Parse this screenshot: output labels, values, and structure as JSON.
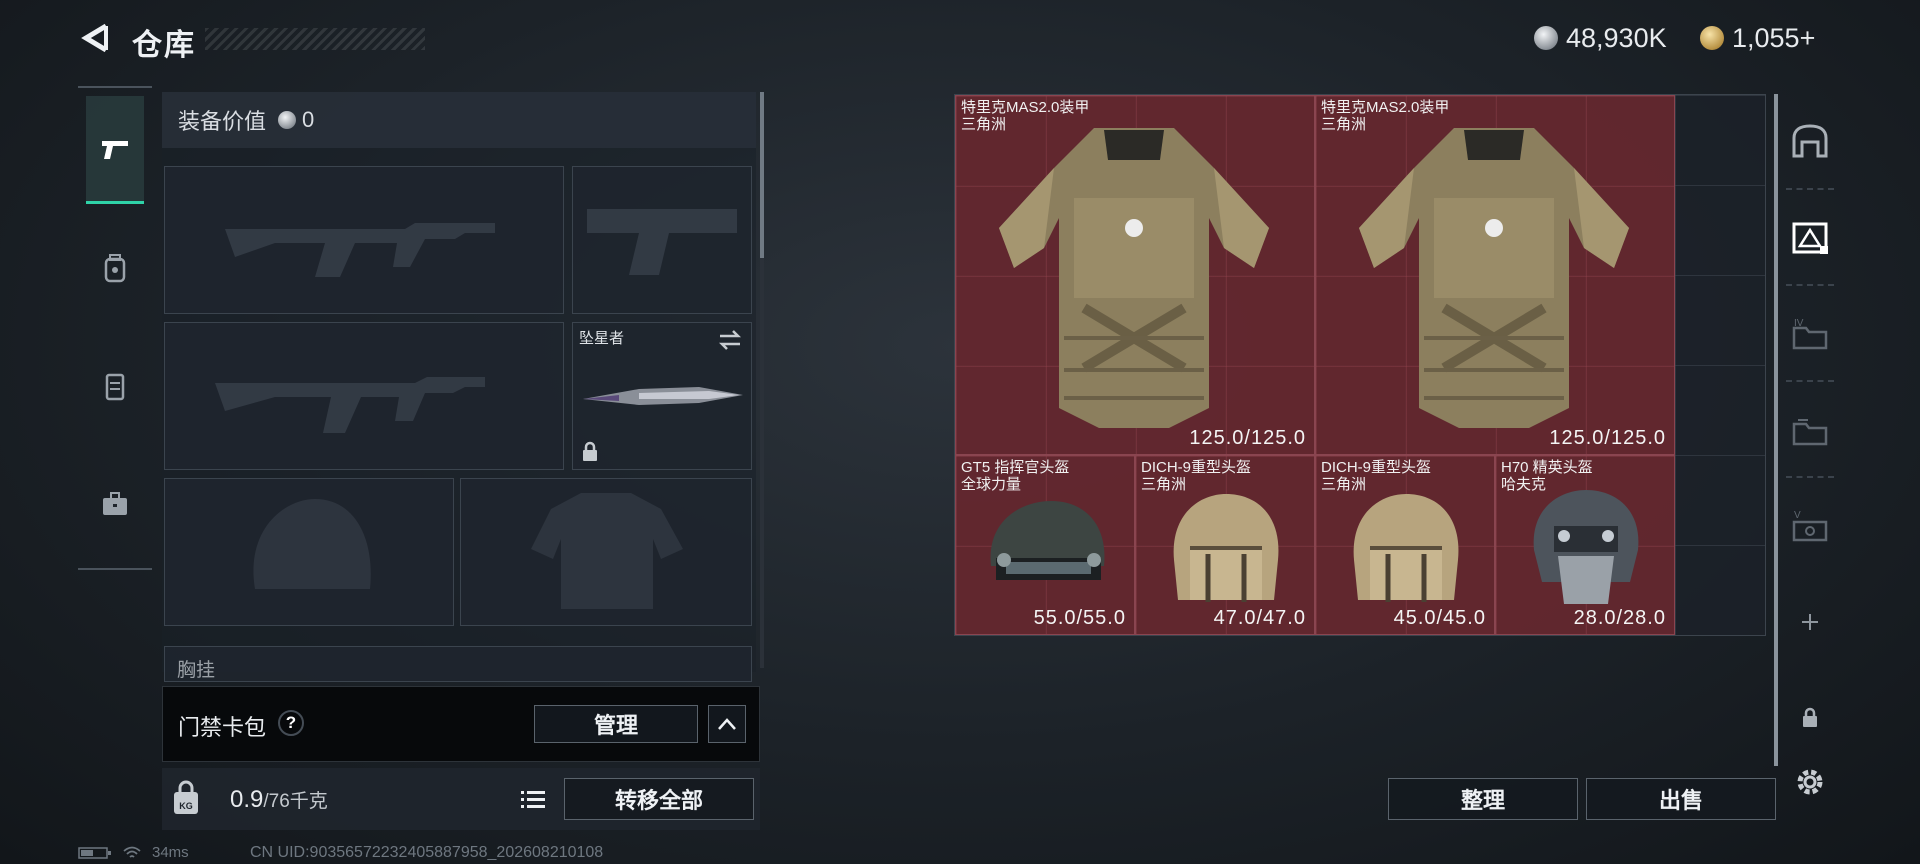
{
  "header": {
    "title": "仓库",
    "currency_silver": "48,930K",
    "currency_gold": "1,055+"
  },
  "equipment": {
    "value_label": "装备价值",
    "value": "0",
    "melee_name": "坠星者",
    "chest_rig_label": "胸挂"
  },
  "keycard": {
    "label": "门禁卡包",
    "help": "?",
    "manage_label": "管理"
  },
  "weight": {
    "current": "0.9",
    "capacity": "/76千克",
    "transfer_all_label": "转移全部"
  },
  "status": {
    "ping": "34ms",
    "uid": "CN UID:9035657223240588​7958_202608210108"
  },
  "storage": {
    "items": [
      {
        "name": "特里克MAS2.0装甲",
        "sub": "三角洲",
        "durability": "125.0/125.0",
        "type": "armor"
      },
      {
        "name": "特里克MAS2.0装甲",
        "sub": "三角洲",
        "durability": "125.0/125.0",
        "type": "armor"
      },
      {
        "name": "GT5 指挥官头盔",
        "sub": "全球力量",
        "durability": "55.0/55.0",
        "type": "helmet"
      },
      {
        "name": "DICH-9重型头盔",
        "sub": "三角洲",
        "durability": "47.0/47.0",
        "type": "helmet"
      },
      {
        "name": "DICH-9重型头盔",
        "sub": "三角洲",
        "durability": "45.0/45.0",
        "type": "helmet"
      },
      {
        "name": "H70 精英头盔",
        "sub": "哈夫克",
        "durability": "28.0/28.0",
        "type": "helmet"
      }
    ]
  },
  "actions": {
    "sort_label": "整理",
    "sell_label": "出售"
  },
  "colors": {
    "accent": "#2fd3a8",
    "item_bg": "#702830"
  }
}
